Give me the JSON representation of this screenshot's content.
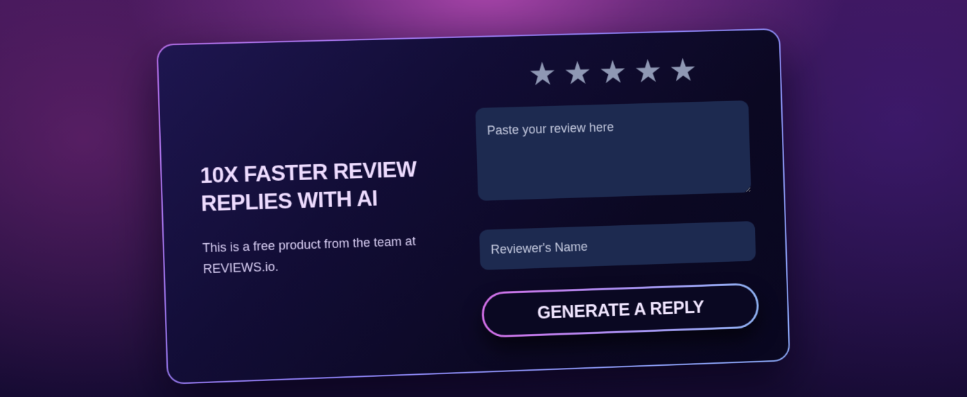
{
  "hero": {
    "title": "10X FASTER REVIEW REPLIES WITH AI",
    "description": "This is a free product from the team at REVIEWS.io."
  },
  "rating": {
    "stars": [
      "★",
      "★",
      "★",
      "★",
      "★"
    ],
    "star_color": "#8f98b4"
  },
  "form": {
    "review_placeholder": "Paste your review here",
    "name_placeholder": "Reviewer's Name",
    "generate_label": "GENERATE A REPLY"
  },
  "colors": {
    "accent_gradient_start": "#d36fe8",
    "accent_gradient_end": "#8fb2f3",
    "card_background": "#0b0822",
    "field_background": "#1d2a50",
    "title_text": "#eedcff"
  }
}
